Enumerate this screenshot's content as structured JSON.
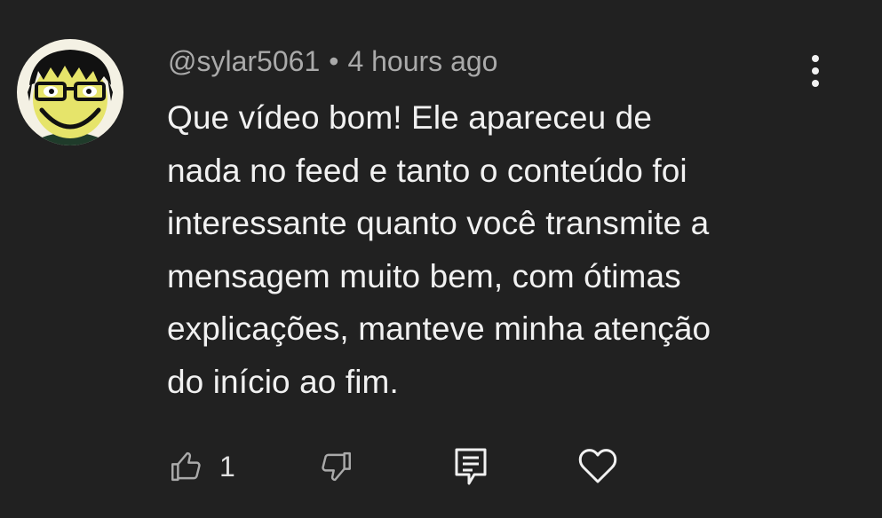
{
  "comment": {
    "author": "@sylar5061",
    "separator": "•",
    "timestamp": "4 hours ago",
    "text_lines": [
      "Que vídeo bom! Ele apareceu de",
      "nada no feed e tanto o conteúdo foi",
      "interessante quanto você transmite a",
      "mensagem muito bem, com ótimas",
      "explicações, manteve minha atenção",
      "do início ao fim."
    ]
  },
  "actions": {
    "like_count": "1",
    "like_icon": "thumbs-up-icon",
    "dislike_icon": "thumbs-down-icon",
    "reply_icon": "reply-comment-icon",
    "heart_icon": "heart-icon",
    "more_icon": "more-vertical-icon"
  },
  "colors": {
    "background": "#212121",
    "text_primary": "#f1f1f1",
    "text_secondary": "#aaaaaa"
  }
}
